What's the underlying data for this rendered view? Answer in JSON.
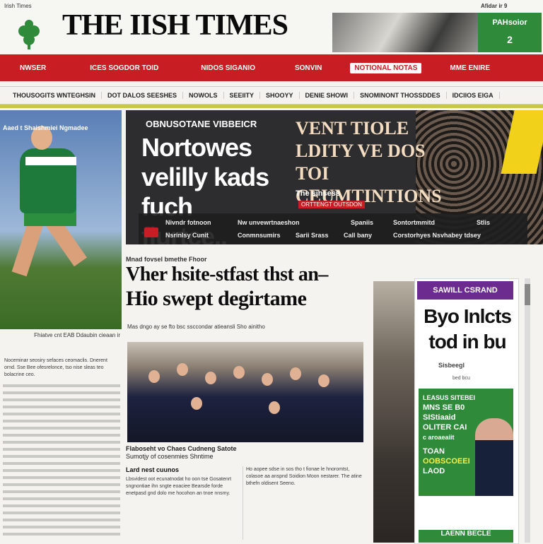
{
  "masthead": {
    "top_left_label": "Irish Times",
    "title": "THE IISH TIMES",
    "promo_title": "PAHsoior",
    "promo_number": "2",
    "top_right_label": "Afidar ir 9"
  },
  "nav": {
    "items": [
      "NWSER",
      "ICES SOGDOR TOID",
      "NIDOS SIGANIO",
      "SONVIN",
      "NOTIONAL NOTAS",
      "MME ENIRE"
    ]
  },
  "subnav": {
    "items": [
      "THOUSOGITS WNTEGHSIN",
      "DOT DALOS SEESHES",
      "NOWOLS",
      "SEEIITY",
      "SHOOYY",
      "DENIE SHOWI",
      "SNOMINONT THOSSDDES",
      "IDCIIOS EIGA"
    ]
  },
  "sport": {
    "label": "Aaed t Shaishmiei Ngmadee"
  },
  "hero": {
    "kicker": "OBNUSOTANE VIBBEICR",
    "headline": "Nortowes velilly kads fuch flurtce..",
    "right_headline": "VENT TIOLE LDITY VE DOS TOI CEUMTINTIONS",
    "small_title": "The sinsess",
    "tag": "ORTTENGT OUTSDON",
    "strip": [
      "Nivndr fotnoon",
      "Nw unvewrtnaeshon",
      "Spaniis",
      "Sontortmmitd",
      "Stlis",
      "Nsrinlsy Cunit",
      "Conmnsumirs",
      "Sarii Srass",
      "Call bany",
      "Corstorhyes Nsvhabey tdsey"
    ]
  },
  "article": {
    "kicker": "Mnad fovsel bmethe Fhoor",
    "headline_line1": "Vher hsite-stfast thst an–",
    "headline_line2": "Hio swept degirtame",
    "deck": "Mas dngo ay se fto bsc ssccondar atieansli Sho ainitho",
    "caption_line1": "Flaboseht vo Chaes Cudneng Satote",
    "caption_line2": "Sumotjy of cosenmies Shntime",
    "byline_left": "Lard nest cuunos",
    "left_body": "Lbsvidest oot ecunatnodat ho oon tse Gosatenrt sngnontiae ihn sngte eoaciee Bearsde forde enetpasd gnd dolo me hocohon an tnoe nnsmy.",
    "right_body": "Ho aopee sdse in sos tho t fionae le hnoromtst, colasoe aa anspnd Soidion Moon nestarer. The atine bthefn oldisent Seeno."
  },
  "left_column": {
    "head": "Fhiatve cnt EAB Ddaubin cieaan ir",
    "body": "Noceminar seosiry sefaces ceomaclis. Dnerent ornd. Sse Bee ofesrelonce, tso nise sleas teo bolacrine ceo."
  },
  "sidebar": {
    "badge": "SAWILL CSRAND",
    "headline": "Byo Inlcts tod in bu",
    "byline": "Sisbeegl",
    "small": "bed bcu",
    "ad_line1": "LEASUS SITEBEI",
    "ad_line2": "MNS SE B0",
    "ad_line3": "SIStiaaid",
    "ad_line4": "OLITER CAI",
    "ad_line5": "c aroaeaiit",
    "ad_line6": "TOAN",
    "ad_line7": "OOBSCOEEI",
    "ad_line8": "LAOD",
    "bottom": "LAENN BECLE"
  },
  "colors": {
    "nav_red": "#c81e23",
    "ad_green": "#2f8b3a",
    "badge_purple": "#6c2c8f"
  }
}
